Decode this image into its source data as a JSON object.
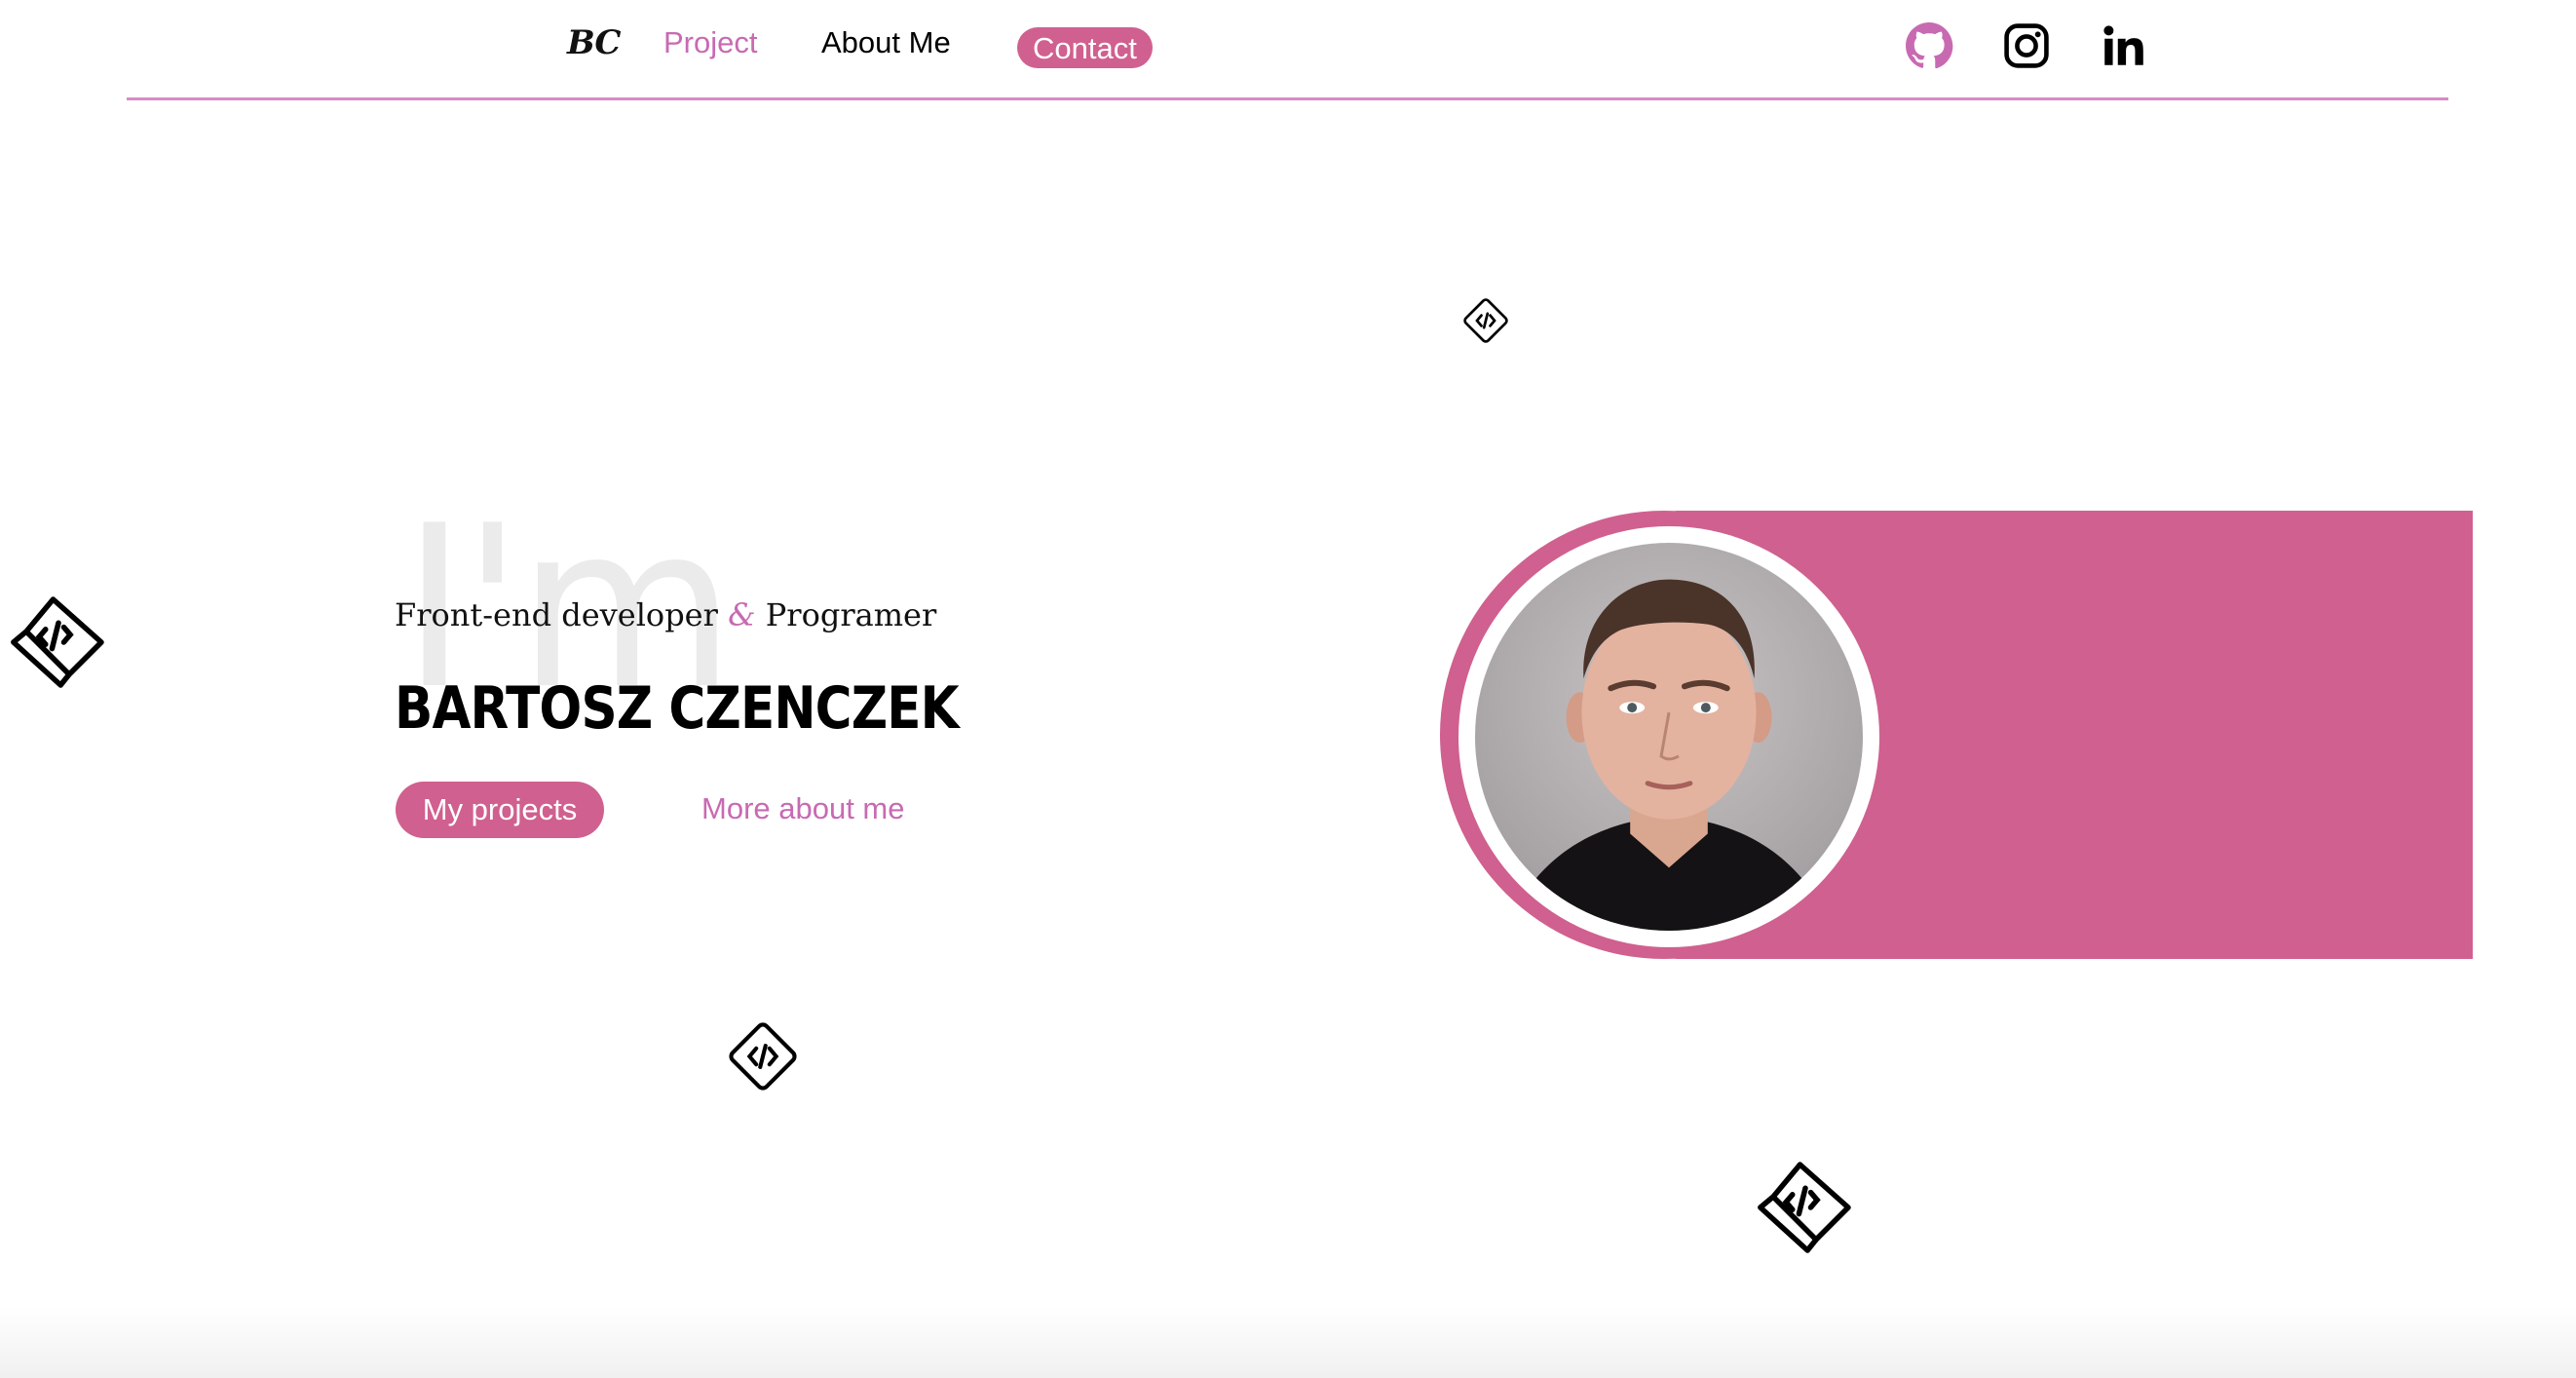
{
  "nav": {
    "logo": "BC",
    "links": [
      {
        "label": "Project",
        "active": true
      },
      {
        "label": "About Me",
        "active": false
      }
    ],
    "contact_label": "Contact",
    "social": [
      "github-icon",
      "instagram-icon",
      "linkedin-icon"
    ]
  },
  "hero": {
    "watermark": "I'm",
    "subtitle_left": "Front-end developer",
    "subtitle_amp": "&",
    "subtitle_right": "Programer",
    "name": "BARTOSZ CZENCZEK",
    "primary_button": "My projects",
    "secondary_link": "More about me"
  },
  "colors": {
    "accent_pink": "#d0608f",
    "link_pink": "#c86ab2",
    "divider": "#d88bc3"
  },
  "decor_icons": [
    "code-tag-icon",
    "code-tag-icon",
    "code-tag-icon",
    "code-tag-icon"
  ]
}
